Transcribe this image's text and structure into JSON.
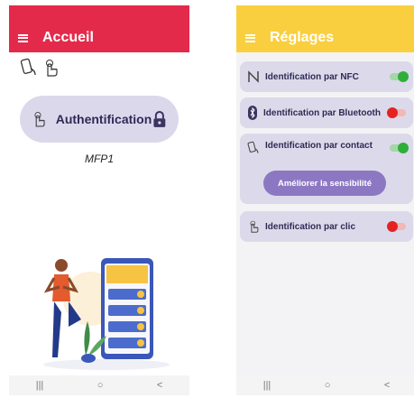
{
  "left": {
    "header": {
      "title": "Accueil"
    },
    "auth_label": "Authentification",
    "device_name": "MFP1"
  },
  "right": {
    "header": {
      "title": "Réglages"
    },
    "settings": [
      {
        "label": "Identification par NFC",
        "state": "on"
      },
      {
        "label": "Identification par Bluetooth",
        "state": "off"
      },
      {
        "label": "Identification par contact",
        "state": "on"
      },
      {
        "label": "Identification par clic",
        "state": "off"
      }
    ],
    "improve_button": "Améliorer la sensibilité"
  },
  "navbar": {
    "recent": "|||",
    "home": "○",
    "back": "<"
  },
  "colors": {
    "left_header": "#e42a4a",
    "right_header": "#f9cf3f",
    "card": "#dcd8ec",
    "accent": "#8c78c2",
    "on": "#2fae3a",
    "off": "#e52222"
  }
}
